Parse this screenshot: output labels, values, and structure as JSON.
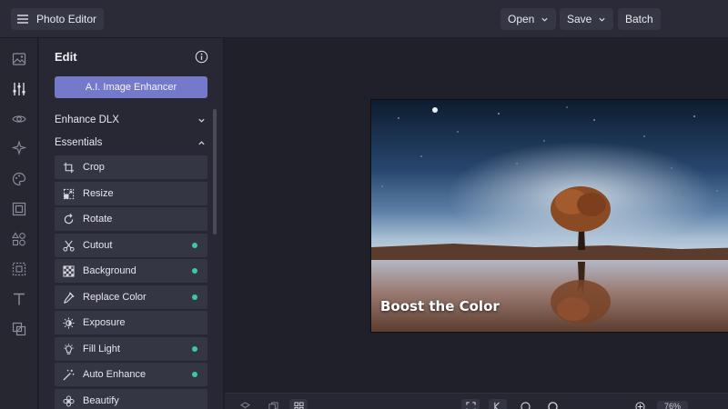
{
  "app": {
    "title": "Photo Editor",
    "menu_icon": "hamburger-icon"
  },
  "toolbar": {
    "open_label": "Open",
    "save_label": "Save",
    "batch_label": "Batch"
  },
  "rail": {
    "icons": [
      "image-icon",
      "sliders-icon",
      "eye-icon",
      "sparkle-icon",
      "palette-icon",
      "frame-icon",
      "shapes-icon",
      "texture-icon",
      "text-icon",
      "overlay-icon"
    ]
  },
  "panel": {
    "title": "Edit",
    "ai_button": "A.I. Image Enhancer",
    "sections": [
      {
        "label": "Enhance DLX",
        "expanded": false
      },
      {
        "label": "Essentials",
        "expanded": true
      }
    ],
    "tools": [
      {
        "label": "Crop",
        "icon": "crop-icon",
        "new": false
      },
      {
        "label": "Resize",
        "icon": "resize-icon",
        "new": false
      },
      {
        "label": "Rotate",
        "icon": "rotate-icon",
        "new": false
      },
      {
        "label": "Cutout",
        "icon": "scissors-icon",
        "new": true
      },
      {
        "label": "Background",
        "icon": "checker-icon",
        "new": true
      },
      {
        "label": "Replace Color",
        "icon": "dropper-icon",
        "new": true
      },
      {
        "label": "Exposure",
        "icon": "exposure-icon",
        "new": false
      },
      {
        "label": "Fill Light",
        "icon": "bulb-icon",
        "new": true
      },
      {
        "label": "Auto Enhance",
        "icon": "wand-icon",
        "new": true
      },
      {
        "label": "Beautify",
        "icon": "flower-icon",
        "new": false
      }
    ],
    "accent_color": "#7479c9",
    "dot_color": "#3fc6a3"
  },
  "canvas": {
    "caption": "Boost the Color"
  },
  "bottom": {
    "zoom": "76%"
  }
}
